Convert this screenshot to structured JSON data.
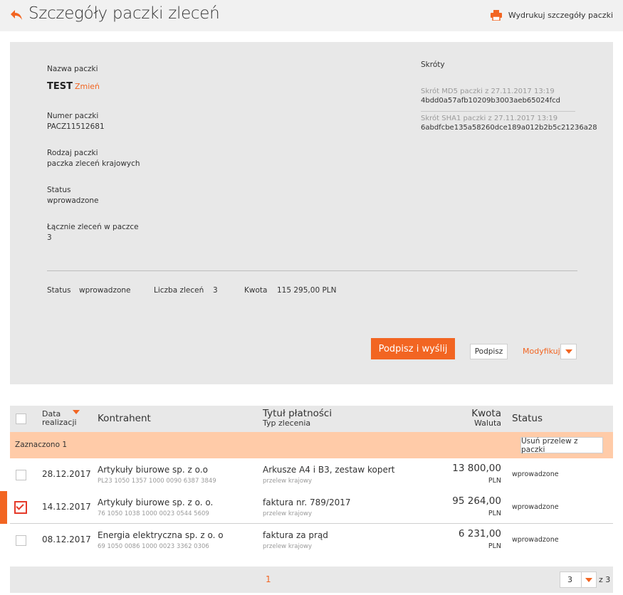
{
  "header": {
    "title": "Szczegóły paczki zleceń",
    "print_label": "Wydrukuj szczegóły paczki"
  },
  "details": {
    "name_label": "Nazwa paczki",
    "name_value": "TEST",
    "change_label": "Zmień",
    "number_label": "Numer paczki",
    "number_value": "PACZ11512681",
    "type_label": "Rodzaj paczki",
    "type_value": "paczka zleceń krajowych",
    "status_label": "Status",
    "status_value": "wprowadzone",
    "total_label": "Łącznie zleceń w paczce",
    "total_value": "3",
    "hashes_label": "Skróty",
    "md5_label": "Skrót MD5 paczki z 27.11.2017 13:19",
    "md5_value": "4bdd0a57afb10209b3003aeb65024fcd",
    "sha1_label": "Skrót SHA1 paczki z 27.11.2017 13:19",
    "sha1_value": "6abdfcbe135a58260dce189a012b2b5c21236a28"
  },
  "summary": {
    "status_label": "Status",
    "status_value": "wprowadzone",
    "count_label": "Liczba zleceń",
    "count_value": "3",
    "amount_label": "Kwota",
    "amount_value": "115 295,00 PLN"
  },
  "actions": {
    "sign_send": "Podpisz i wyślij",
    "sign": "Podpisz",
    "modify": "Modyfikuj"
  },
  "table": {
    "col_date_1": "Data",
    "col_date_2": "realizacji",
    "col_contractor": "Kontrahent",
    "col_title": "Tytuł płatności",
    "col_type": "Typ zlecenia",
    "col_amount": "Kwota",
    "col_currency": "Waluta",
    "col_status": "Status",
    "selected_text": "Zaznaczono 1",
    "remove_label": "Usuń przelew z paczki",
    "rows": [
      {
        "date": "28.12.2017",
        "name": "Artykuły biurowe sp. z o.o",
        "account": "PL23 1050 1357 1000 0090 6387 3849",
        "title": "Arkusze A4 i B3, zestaw kopert",
        "type": "przelew krajowy",
        "amount": "13 800,00",
        "currency": "PLN",
        "status": "wprowadzone",
        "checked": false
      },
      {
        "date": "14.12.2017",
        "name": "Artykuły biurowe sp. z o. o.",
        "account": "76 1050 1038 1000 0023 0544 5609",
        "title": "faktura nr. 789/2017",
        "type": "przelew krajowy",
        "amount": "95 264,00",
        "currency": "PLN",
        "status": "wprowadzone",
        "checked": true
      },
      {
        "date": "08.12.2017",
        "name": "Energia elektryczna sp. z o. o",
        "account": "69 1050 0086 1000 0023 3362 0306",
        "title": "faktura za prąd",
        "type": "przelew krajowy",
        "amount": "6 231,00",
        "currency": "PLN",
        "status": "wprowadzone",
        "checked": false
      }
    ]
  },
  "pagination": {
    "current_page": "1",
    "select_value": "3",
    "of_label": "z 3"
  },
  "colors": {
    "accent": "#f26522",
    "panel_bg": "#e8e8e8",
    "selection_bg": "#ffcba8"
  }
}
